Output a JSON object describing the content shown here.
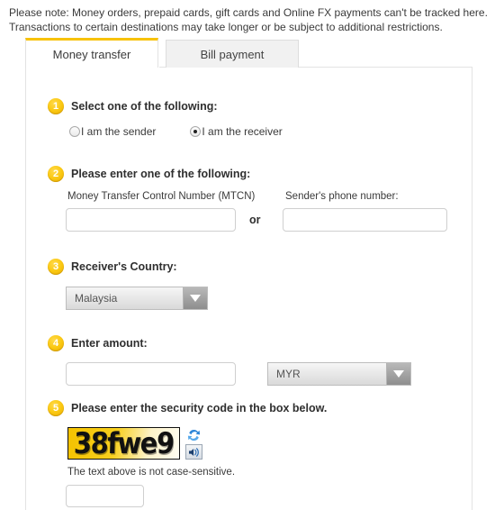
{
  "note": {
    "line1": "Please note: Money orders, prepaid cards, gift cards and Online FX payments can't be tracked here.",
    "line2": "Transactions to certain destinations may take longer or be subject to additional restrictions."
  },
  "tabs": [
    {
      "label": "Money transfer",
      "active": true
    },
    {
      "label": "Bill payment",
      "active": false
    }
  ],
  "steps": {
    "step1": {
      "number": "1",
      "title": "Select one of the following:",
      "options": [
        {
          "label": "I am the sender",
          "selected": false
        },
        {
          "label": "I am the receiver",
          "selected": true
        }
      ]
    },
    "step2": {
      "number": "2",
      "title": "Please enter one of the following:",
      "mtcn_label": "Money Transfer Control Number (MTCN)",
      "mtcn_value": "",
      "or_label": "or",
      "phone_label": "Sender's phone number:",
      "phone_value": ""
    },
    "step3": {
      "number": "3",
      "title": "Receiver's Country:",
      "country_value": "Malaysia",
      "arrow_icon": "chevron-down-icon"
    },
    "step4": {
      "number": "4",
      "title": "Enter amount:",
      "amount_value": "",
      "currency_value": "MYR",
      "arrow_icon": "chevron-down-icon"
    },
    "step5": {
      "number": "5",
      "title": "Please enter the security code in the box below.",
      "captcha_text": "38fwe9",
      "refresh_icon": "refresh-icon",
      "audio_icon": "speaker-icon",
      "hint": "The text above is not case-sensitive.",
      "code_value": ""
    }
  },
  "colors": {
    "accent_yellow": "#f7c20a",
    "badge_gold": "#fbc913",
    "captcha_yellow": "#f4c200",
    "panel_border": "#e3e3e3",
    "tab_inactive_bg": "#f1f1f1"
  }
}
